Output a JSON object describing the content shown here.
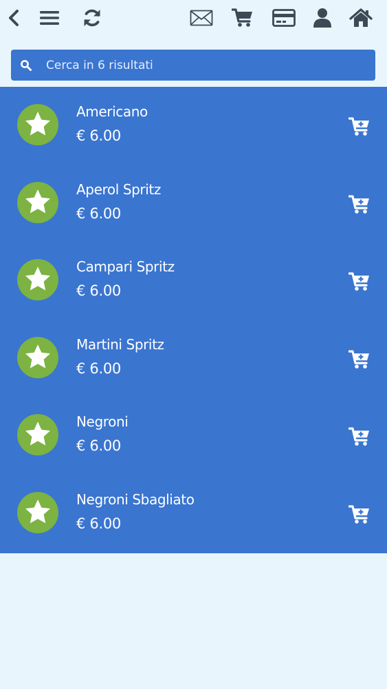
{
  "colors": {
    "page_background": "#e9f5fd",
    "list_background": "#3a75d0",
    "toolbar_icon": "#3d4a55",
    "avatar_green": "#7cb342",
    "text": "#ffffff"
  },
  "toolbar": {
    "icons": [
      "back-chevron-icon",
      "menu-icon",
      "refresh-icon",
      "mail-icon",
      "cart-icon",
      "credit-card-icon",
      "user-icon",
      "home-icon"
    ]
  },
  "search": {
    "placeholder": "Cerca in 6 risultati",
    "value": ""
  },
  "products": [
    {
      "name": "Americano",
      "price": "€ 6.00"
    },
    {
      "name": "Aperol Spritz",
      "price": "€ 6.00"
    },
    {
      "name": "Campari Spritz",
      "price": "€ 6.00"
    },
    {
      "name": "Martini Spritz",
      "price": "€ 6.00"
    },
    {
      "name": "Negroni",
      "price": "€ 6.00"
    },
    {
      "name": "Negroni Sbagliato",
      "price": "€ 6.00"
    }
  ]
}
